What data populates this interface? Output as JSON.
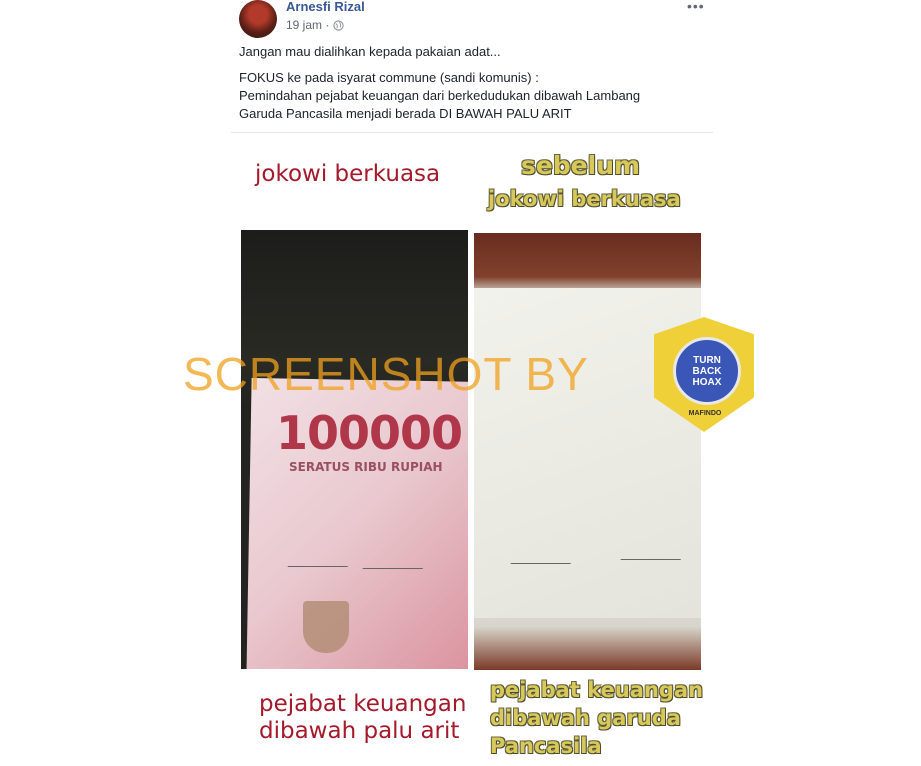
{
  "post": {
    "author": "Arnesfi Rizal",
    "time": "19 jam ·",
    "more": "•••",
    "line1": "Jangan mau dialihkan kepada pakaian adat...",
    "line2": "FOKUS ke pada isyarat commune (sandi komunis) :",
    "line3": "Pemindahan pejabat keuangan dari berkedudukan dibawah Lambang",
    "line4": "Garuda Pancasila menjadi berada DI BAWAH PALU ARIT"
  },
  "image": {
    "left_caption_top": "jokowi berkuasa",
    "right_caption_top_1": "sebelum",
    "right_caption_top_2": "jokowi berkuasa",
    "amount": "100000",
    "amount_words": "SERATUS RIBU RUPIAH",
    "left_caption_bottom_1": "pejabat keuangan",
    "left_caption_bottom_2": "dibawah palu arit",
    "right_caption_bottom_1": "pejabat keuangan",
    "right_caption_bottom_2": "dibawah garuda",
    "right_caption_bottom_3": "Pancasila",
    "watermark": "SCREENSHOT BY",
    "badge_text_1": "TURN",
    "badge_text_2": "BACK",
    "badge_text_3": "HOAX",
    "badge_ring": "MAFINDO"
  },
  "colors": {
    "link": "#385898",
    "caption_red": "#a5192a",
    "caption_yellow": "#d8c85a",
    "watermark": "#f0a01e"
  }
}
